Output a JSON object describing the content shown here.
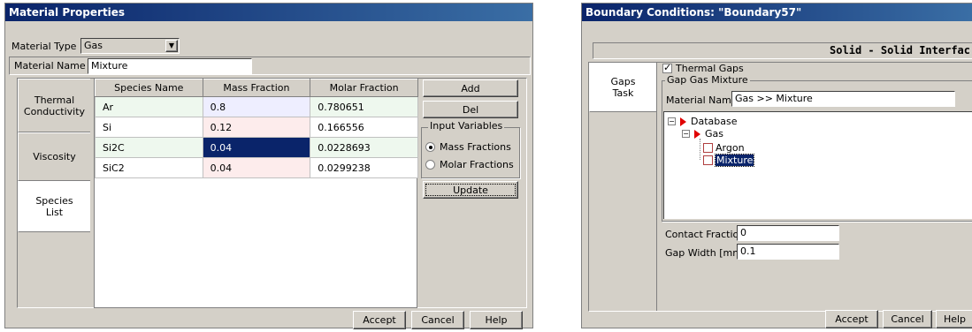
{
  "material_window": {
    "title": "Material Properties",
    "material_type_label": "Material Type",
    "material_type_value": "Gas",
    "material_name_label": "Material Name",
    "material_name_value": "Mixture",
    "tabs": [
      {
        "label": "Thermal\nConductivity"
      },
      {
        "label": "Viscosity"
      },
      {
        "label": "Species\nList"
      }
    ],
    "table": {
      "headers": [
        "Species Name",
        "Mass Fraction",
        "Molar Fraction"
      ],
      "rows": [
        {
          "name": "Ar",
          "mass": "0.8",
          "molar": "0.780651"
        },
        {
          "name": "Si",
          "mass": "0.12",
          "molar": "0.166556"
        },
        {
          "name": "Si2C",
          "mass": "0.04",
          "molar": "0.0228693"
        },
        {
          "name": "SiC2",
          "mass": "0.04",
          "molar": "0.0299238"
        }
      ]
    },
    "add_label": "Add",
    "del_label": "Del",
    "input_variables_label": "Input Variables",
    "mass_fractions_label": "Mass Fractions",
    "molar_fractions_label": "Molar Fractions",
    "update_label": "Update",
    "accept_label": "Accept",
    "cancel_label": "Cancel",
    "help_label": "Help"
  },
  "boundary_window": {
    "title": "Boundary Conditions: \"Boundary57\"",
    "header_text": "Solid - Solid Interfac",
    "tab_label": "Gaps\nTask",
    "thermal_gaps_label": "Thermal Gaps",
    "gap_gas_mixture_label": "Gap Gas Mixture",
    "material_name_label": "Material Name:",
    "material_name_value": "Gas >> Mixture",
    "tree": {
      "database": "Database",
      "gas": "Gas",
      "argon": "Argon",
      "mixture": "Mixture"
    },
    "contact_fraction_label": "Contact Fraction",
    "contact_fraction_value": "0",
    "gap_width_label": "Gap Width [mm]",
    "gap_width_value": "0.1",
    "accept_label": "Accept",
    "cancel_label": "Cancel",
    "help_label": "Help"
  },
  "colors": {
    "titlebar": "#0a246a",
    "selection": "#0a246a",
    "tree_triangle": "#e00000"
  }
}
